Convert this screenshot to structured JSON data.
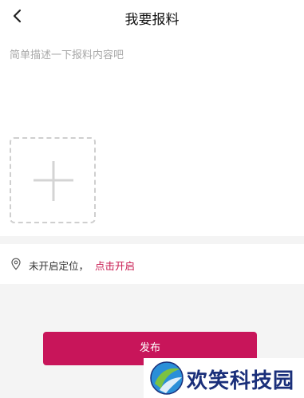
{
  "header": {
    "title": "我要报料",
    "back_icon": "chevron-left-icon"
  },
  "compose": {
    "placeholder": "简单描述一下报料内容吧",
    "value": "",
    "add_photo_icon": "plus-icon"
  },
  "location": {
    "icon": "map-pin-icon",
    "status_text": "未开启定位，",
    "enable_link": "点击开启",
    "link_color": "#c8184f"
  },
  "actions": {
    "publish_label": "发布",
    "accent_color": "#c8155a"
  },
  "watermark": {
    "text": "欢笑科技园"
  }
}
